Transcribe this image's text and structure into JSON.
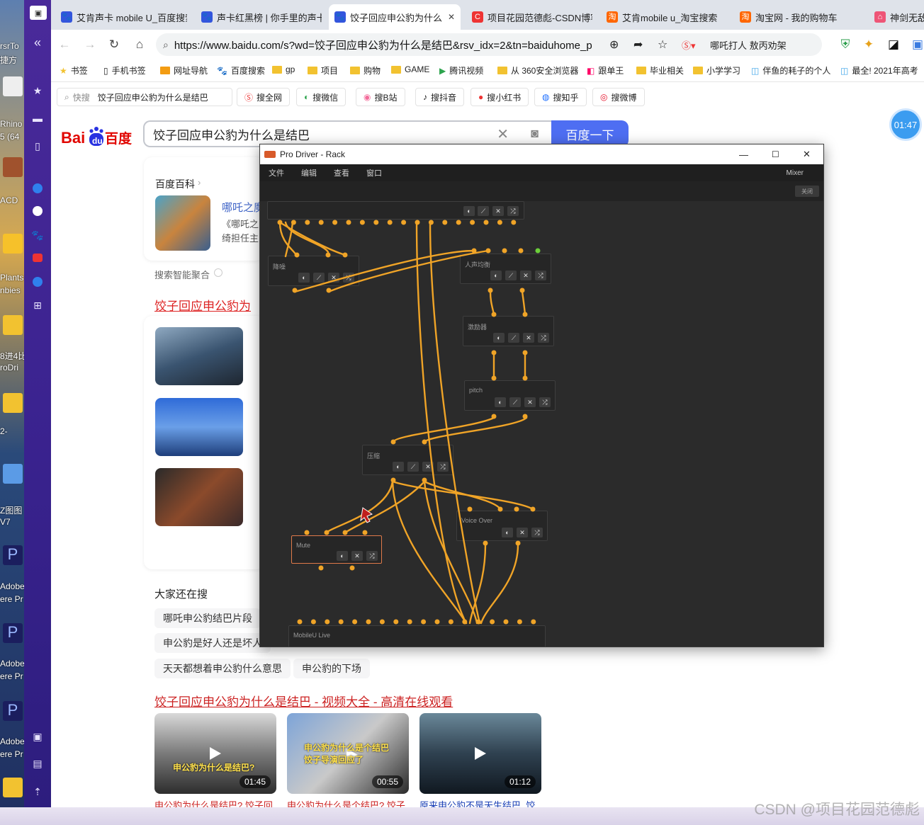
{
  "desktop": {
    "labels": [
      "rsrTo",
      "捷方",
      "Rhino",
      "5 (64",
      "ACD",
      "Plants",
      "nbies",
      "8进4比",
      "roDri",
      "2-",
      "Z图图",
      "V7",
      "Adobe",
      "ere Pr",
      "Adobe",
      "ere Pr",
      "Adobe",
      "ere Pr"
    ]
  },
  "browser": {
    "tabs": [
      {
        "label": "艾肯声卡 mobile U_百度搜索",
        "icon": "baidu-paw-icon",
        "color": "#3355dd"
      },
      {
        "label": "声卡红黑榜 | 你手里的声卡",
        "icon": "baidu-paw-icon",
        "color": "#3355dd"
      },
      {
        "label": "饺子回应申公豹为什么是结巴",
        "icon": "baidu-paw-icon",
        "color": "#3355dd"
      },
      {
        "label": "项目花园范德彪-CSDN博客",
        "icon": "csdn-icon",
        "color": "#e33"
      },
      {
        "label": "艾肯mobile u_淘宝搜索",
        "icon": "taobao-icon",
        "color": "#f60"
      },
      {
        "label": "淘宝网 - 我的购物车",
        "icon": "taobao-icon",
        "color": "#f60"
      },
      {
        "label": "神剑无敌",
        "icon": "home-icon",
        "color": "#e57"
      }
    ],
    "url": "https://www.baidu.com/s?wd=饺子回应申公豹为什么是结巴&rsv_idx=2&tn=baiduhome_p",
    "url_hint": "哪吒打人 敖丙劝架",
    "bookmarks": [
      "书签",
      "手机书签",
      "网址导航",
      "百度搜索",
      "gp",
      "项目",
      "购物",
      "GAME",
      "腾讯视频",
      "从 360安全浏览器",
      "跟单王",
      "毕业相关",
      "小学学习",
      "伴鱼的耗子的个人",
      "最全! 2021年高考"
    ],
    "quick_prefix": "快搜",
    "quick_query": "饺子回应申公豹为什么是结巴",
    "quick_buttons": [
      "搜全网",
      "搜微信",
      "搜B站",
      "搜抖音",
      "搜小红书",
      "搜知乎",
      "搜微博"
    ]
  },
  "baidu": {
    "search_query": "饺子回应申公豹为什么是结巴",
    "search_button": "百度一下",
    "baike_label": "百度百科",
    "baike_title": "哪吒之魔",
    "baike_desc1": "《哪吒之",
    "baike_desc2": "绮担任主",
    "smart_label": "搜索智能聚合",
    "result1_title": "饺子回应申公豹为",
    "also_search_label": "大家还在搜",
    "also_search": [
      "哪吒申公豹结巴片段",
      "申公豹是好人还是坏人",
      "天天都想着申公豹什么意思",
      "申公豹的下场"
    ],
    "video_title": "饺子回应申公豹为什么是结巴 - 视频大全 - 高清在线观看",
    "videos": [
      {
        "duration": "01:45",
        "caption": "申公豹为什么是结巴? 饺子回",
        "overlay": "申公豹为什么是结巴?"
      },
      {
        "duration": "00:55",
        "caption": "申公豹为什么是个结巴? 饺子",
        "overlay": "申公豹为什么是个结巴 饺子导演回应了"
      },
      {
        "duration": "01:12",
        "caption": "原来申公豹不是天生结巴, 饺",
        "overlay": ""
      }
    ],
    "timer": "01:47"
  },
  "prodriver": {
    "title": "Pro Driver - Rack",
    "menu": [
      "文件",
      "编辑",
      "查看",
      "窗口"
    ],
    "mixer_label": "Mixer",
    "close_label": "关闭",
    "nodes": {
      "n1": "降噪",
      "n2": "人声均衡",
      "n3": "激励器",
      "n4": "pitch",
      "n5": "压缩",
      "n6": "Voice Over",
      "n7": "Mute",
      "n8": "MobileU Live"
    }
  },
  "watermark": "CSDN @项目花园范德彪"
}
